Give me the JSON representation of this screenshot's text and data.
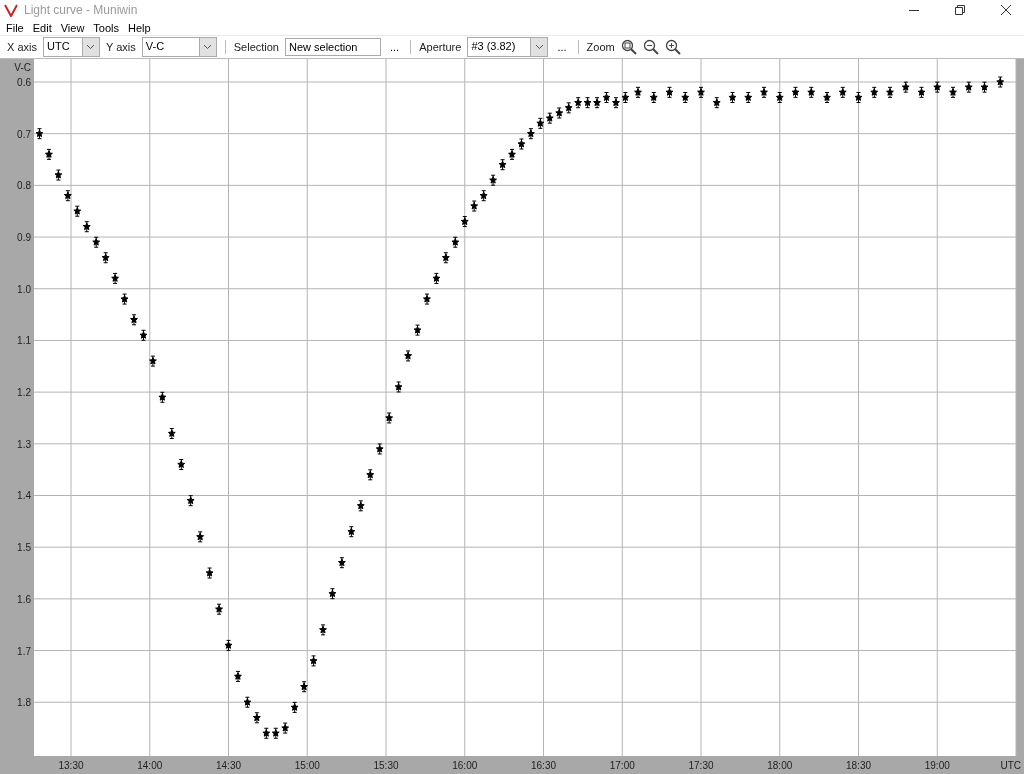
{
  "window": {
    "title": "Light curve - Muniwin"
  },
  "menu": [
    {
      "label": "File"
    },
    {
      "label": "Edit"
    },
    {
      "label": "View"
    },
    {
      "label": "Tools"
    },
    {
      "label": "Help"
    }
  ],
  "toolbar": [
    {
      "kind": "label",
      "text": "X axis"
    },
    {
      "kind": "combo",
      "value": "UTC"
    },
    {
      "kind": "label",
      "text": "Y axis"
    },
    {
      "kind": "combo",
      "value": "V-C"
    },
    {
      "kind": "separator"
    },
    {
      "kind": "label",
      "text": "Selection"
    },
    {
      "kind": "input",
      "value": "New selection"
    },
    {
      "kind": "more",
      "text": "..."
    },
    {
      "kind": "separator"
    },
    {
      "kind": "label",
      "text": "Aperture"
    },
    {
      "kind": "combo",
      "value": "#3 (3.82)"
    },
    {
      "kind": "more",
      "text": "..."
    },
    {
      "kind": "separator"
    },
    {
      "kind": "label",
      "text": "Zoom"
    },
    {
      "kind": "zoom-fit"
    },
    {
      "kind": "zoom-out"
    },
    {
      "kind": "zoom-in"
    }
  ],
  "chart_data": {
    "type": "scatter",
    "grid": true,
    "xlabel": "UTC",
    "ylabel": "V-C",
    "xlim": [
      13.265,
      19.5
    ],
    "ylim": [
      1.904,
      0.5555
    ],
    "xticks": [
      {
        "value": 13.5,
        "label": "13:30"
      },
      {
        "value": 14,
        "label": "14:00"
      },
      {
        "value": 14.5,
        "label": "14:30"
      },
      {
        "value": 15,
        "label": "15:00"
      },
      {
        "value": 15.5,
        "label": "15:30"
      },
      {
        "value": 16,
        "label": "16:00"
      },
      {
        "value": 16.5,
        "label": "16:30"
      },
      {
        "value": 17,
        "label": "17:00"
      },
      {
        "value": 17.5,
        "label": "17:30"
      },
      {
        "value": 18,
        "label": "18:00"
      },
      {
        "value": 18.5,
        "label": "18:30"
      },
      {
        "value": 19,
        "label": "19:00"
      }
    ],
    "yticks": [
      {
        "value": 0.6,
        "label": "0.6"
      },
      {
        "value": 0.7,
        "label": "0.7"
      },
      {
        "value": 0.8,
        "label": "0.8"
      },
      {
        "value": 0.9,
        "label": "0.9"
      },
      {
        "value": 1.0,
        "label": "1.0"
      },
      {
        "value": 1.1,
        "label": "1.1"
      },
      {
        "value": 1.2,
        "label": "1.2"
      },
      {
        "value": 1.3,
        "label": "1.3"
      },
      {
        "value": 1.4,
        "label": "1.4"
      },
      {
        "value": 1.5,
        "label": "1.5"
      },
      {
        "value": 1.6,
        "label": "1.6"
      },
      {
        "value": 1.7,
        "label": "1.7"
      },
      {
        "value": 1.8,
        "label": "1.8"
      }
    ],
    "x": [
      13.3,
      13.36,
      13.42,
      13.48,
      13.54,
      13.6,
      13.66,
      13.72,
      13.78,
      13.84,
      13.9,
      13.96,
      14.02,
      14.08,
      14.14,
      14.2,
      14.26,
      14.32,
      14.38,
      14.44,
      14.5,
      14.56,
      14.62,
      14.68,
      14.74,
      14.8,
      14.86,
      14.92,
      14.98,
      15.04,
      15.1,
      15.16,
      15.22,
      15.28,
      15.34,
      15.4,
      15.46,
      15.52,
      15.58,
      15.64,
      15.7,
      15.76,
      15.82,
      15.88,
      15.94,
      16.0,
      16.06,
      16.12,
      16.18,
      16.24,
      16.3,
      16.36,
      16.42,
      16.48,
      16.54,
      16.6,
      16.66,
      16.72,
      16.78,
      16.84,
      16.9,
      16.96,
      17.02,
      17.1,
      17.2,
      17.3,
      17.4,
      17.5,
      17.6,
      17.7,
      17.8,
      17.9,
      18.0,
      18.1,
      18.2,
      18.3,
      18.4,
      18.5,
      18.6,
      18.7,
      18.8,
      18.9,
      19.0,
      19.1,
      19.2,
      19.3,
      19.4
    ],
    "series": [
      {
        "color": "#000000",
        "values": [
          0.7,
          0.74,
          0.78,
          0.82,
          0.85,
          0.88,
          0.91,
          0.94,
          0.98,
          1.02,
          1.06,
          1.09,
          1.14,
          1.21,
          1.28,
          1.34,
          1.41,
          1.48,
          1.55,
          1.62,
          1.69,
          1.75,
          1.8,
          1.83,
          1.86,
          1.86,
          1.85,
          1.81,
          1.77,
          1.72,
          1.66,
          1.59,
          1.53,
          1.47,
          1.42,
          1.36,
          1.31,
          1.25,
          1.19,
          1.13,
          1.08,
          1.02,
          0.98,
          0.94,
          0.91,
          0.87,
          0.84,
          0.82,
          0.79,
          0.76,
          0.74,
          0.72,
          0.7,
          0.68,
          0.67,
          0.66,
          0.65,
          0.64,
          0.64,
          0.64,
          0.63,
          0.64,
          0.63,
          0.62,
          0.63,
          0.62,
          0.63,
          0.62,
          0.64,
          0.63,
          0.63,
          0.62,
          0.63,
          0.62,
          0.62,
          0.63,
          0.62,
          0.63,
          0.62,
          0.62,
          0.61,
          0.62,
          0.61,
          0.62,
          0.61,
          0.61,
          0.6
        ]
      }
    ]
  }
}
